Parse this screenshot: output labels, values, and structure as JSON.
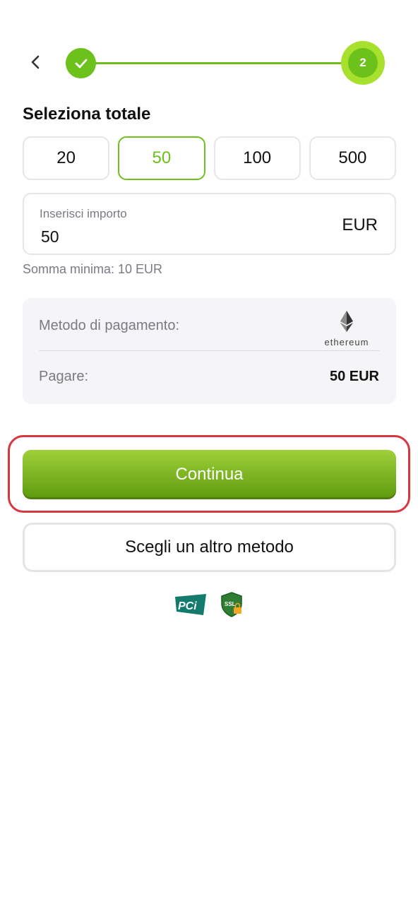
{
  "header": {
    "back_icon": "chevron-left-icon",
    "steps": [
      {
        "state": "done",
        "icon": "check-icon"
      },
      {
        "state": "current",
        "number": "2"
      }
    ],
    "accent_color": "#6cc11b"
  },
  "amount_section": {
    "title": "Seleziona totale",
    "options": [
      "20",
      "50",
      "100",
      "500"
    ],
    "selected": "50"
  },
  "amount_input": {
    "label": "Inserisci importo",
    "value": "50",
    "currency": "EUR"
  },
  "min_sum": "Somma minima: 10 EUR",
  "summary": {
    "method_label": "Metodo di pagamento:",
    "method_logo_text": "ethereum",
    "method_icon": "ethereum-icon",
    "pay_label": "Pagare:",
    "pay_value": "50 EUR"
  },
  "actions": {
    "continue_label": "Continua",
    "other_method_label": "Scegli un altro metodo"
  },
  "badges": {
    "pci_text": "PCi",
    "ssl_text": "SSL"
  },
  "colors": {
    "highlight": "#d7373f",
    "button_top": "#9fd03a",
    "button_bottom": "#5e9a0e"
  }
}
